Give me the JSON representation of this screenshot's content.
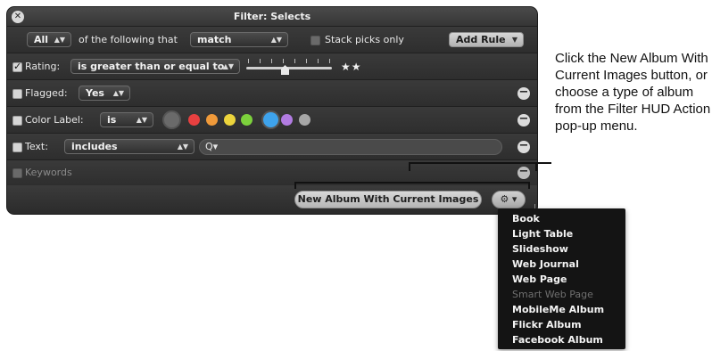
{
  "window": {
    "title": "Filter: Selects",
    "close_icon": "close-icon"
  },
  "header_row": {
    "scope_value": "All",
    "of_following_text": "of the following that",
    "condition_value": "match",
    "stack_picks_label": "Stack picks only",
    "stack_picks_checked": false,
    "add_rule_label": "Add Rule"
  },
  "rating": {
    "checked": true,
    "label": "Rating:",
    "operator": "is greater than or equal to",
    "stars": "★★",
    "star_count": 2
  },
  "flagged": {
    "checked": false,
    "label": "Flagged:",
    "value": "Yes"
  },
  "color_label": {
    "checked": false,
    "label": "Color Label:",
    "operator": "is",
    "colors": [
      "#6a6a6a",
      "#e84040",
      "#f09a3a",
      "#ecd43c",
      "#7cd13c",
      "#3ea3ec",
      "#b27ce2",
      "#a7a7a7"
    ]
  },
  "text_filter": {
    "checked": false,
    "label": "Text:",
    "operator": "includes",
    "search_icon": "Q▾",
    "search_value": ""
  },
  "keywords": {
    "checked": false,
    "label": "Keywords"
  },
  "footer": {
    "new_album_label": "New Album With Current Images",
    "action_icon": "⚙ ▾"
  },
  "action_menu": {
    "items": [
      {
        "label": "Book",
        "enabled": true
      },
      {
        "label": "Light Table",
        "enabled": true
      },
      {
        "label": "Slideshow",
        "enabled": true
      },
      {
        "label": "Web Journal",
        "enabled": true
      },
      {
        "label": "Web Page",
        "enabled": true
      },
      {
        "label": "Smart Web Page",
        "enabled": false
      },
      {
        "label": "MobileMe Album",
        "enabled": true
      },
      {
        "label": "Flickr Album",
        "enabled": true
      },
      {
        "label": "Facebook Album",
        "enabled": true
      }
    ]
  },
  "caption": {
    "text": "Click the New Album With Current Images button, or choose a type of album from the Filter HUD Action pop-up menu."
  }
}
